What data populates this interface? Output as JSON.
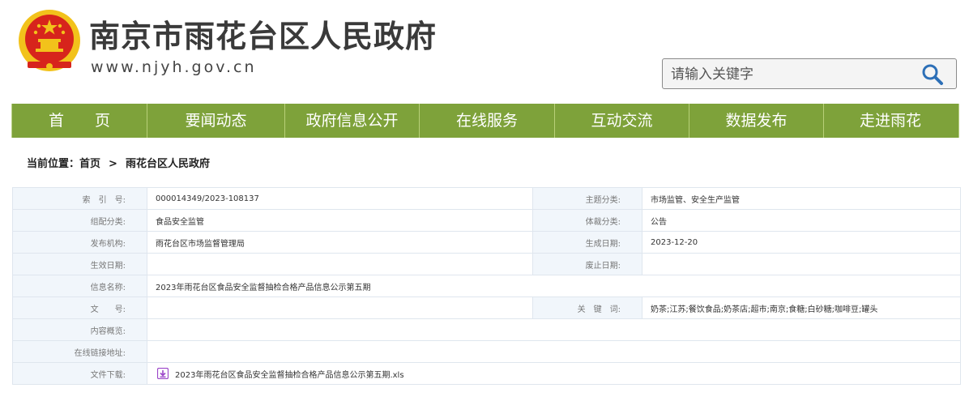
{
  "header": {
    "site_title": "南京市雨花台区人民政府",
    "site_url": "www.njyh.gov.cn",
    "search_placeholder": "请输入关键字"
  },
  "colors": {
    "nav_bg": "#7ea23a",
    "label_bg": "#f1f6fb",
    "emblem_red": "#d7241c",
    "emblem_gold": "#f2c21b"
  },
  "nav": {
    "items": [
      {
        "label": "首　　页"
      },
      {
        "label": "要闻动态"
      },
      {
        "label": "政府信息公开"
      },
      {
        "label": "在线服务"
      },
      {
        "label": "互动交流"
      },
      {
        "label": "数据发布"
      },
      {
        "label": "走进雨花"
      }
    ]
  },
  "breadcrumb": {
    "prefix": "当前位置：",
    "home": "首页",
    "separator": ">",
    "current": "雨花台区人民政府"
  },
  "info": {
    "index_no_label": "索　引　号:",
    "index_no": "000014349/2023-108137",
    "topic_label": "主题分类:",
    "topic": "市场监管、安全生产监管",
    "org_category_label": "组配分类:",
    "org_category": "食品安全监管",
    "genre_label": "体裁分类:",
    "genre": "公告",
    "publisher_label": "发布机构:",
    "publisher": "雨花台区市场监督管理局",
    "created_label": "生成日期:",
    "created": "2023-12-20",
    "effective_label": "生效日期:",
    "effective": "",
    "abolished_label": "废止日期:",
    "abolished": "",
    "name_label": "信息名称:",
    "name": "2023年雨花台区食品安全监督抽检合格产品信息公示第五期",
    "doc_no_label": "文　　号:",
    "doc_no": "",
    "keywords_label": "关　键　词:",
    "keywords": "奶茶;江苏;餐饮食品;奶茶店;超市;南京;食糖;白砂糖;咖啡豆;罐头",
    "overview_label": "内容概览:",
    "overview": "",
    "online_link_label": "在线链接地址:",
    "online_link": "",
    "download_label": "文件下载:",
    "download_file": "2023年雨花台区食品安全监督抽检合格产品信息公示第五期.xls",
    "download_icon": "download-file-icon"
  }
}
